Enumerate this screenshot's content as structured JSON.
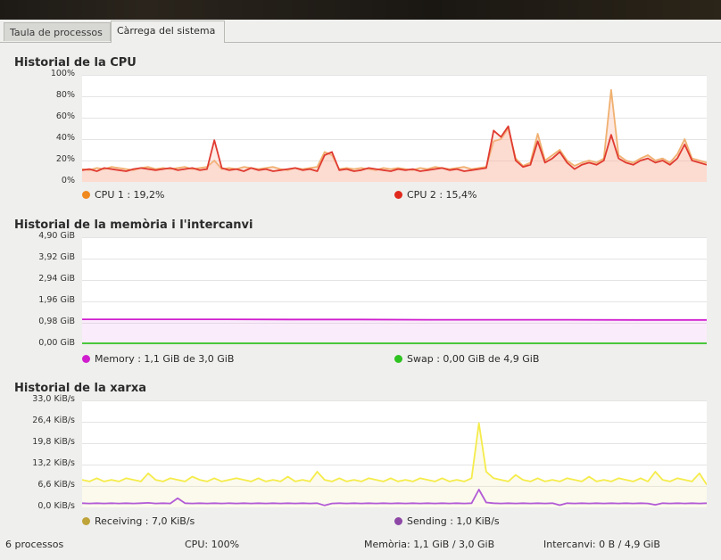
{
  "tabs": [
    {
      "label": "Taula de processos"
    },
    {
      "label": "Càrrega del sistema"
    }
  ],
  "cpu": {
    "title": "Historial de la CPU",
    "yticks": [
      "100%",
      "80%",
      "60%",
      "40%",
      "20%",
      "0%"
    ],
    "legend": [
      {
        "label": "CPU 1 : 19,2%",
        "color": "#f0891e"
      },
      {
        "label": "CPU 2 : 15,4%",
        "color": "#e02a1d"
      }
    ]
  },
  "memory": {
    "title": "Historial de la memòria i l'intercanvi",
    "yticks": [
      "4,90 GiB",
      "3,92 GiB",
      "2,94 GiB",
      "1,96 GiB",
      "0,98 GiB",
      "0,00 GiB"
    ],
    "legend": [
      {
        "label": "Memory : 1,1 GiB de 3,0 GiB",
        "color": "#d01ecf"
      },
      {
        "label": "Swap : 0,00 GiB de 4,9 GiB",
        "color": "#2ec320"
      }
    ]
  },
  "network": {
    "title": "Historial de la xarxa",
    "yticks": [
      "33,0 KiB/s",
      "26,4 KiB/s",
      "19,8 KiB/s",
      "13,2 KiB/s",
      "6,6 KiB/s",
      "0,0 KiB/s"
    ],
    "legend": [
      {
        "label": "Receiving : 7,0 KiB/s",
        "color": "#bfa43a"
      },
      {
        "label": "Sending : 1,0 KiB/s",
        "color": "#8d48a6"
      }
    ]
  },
  "status": {
    "processes": "6 processos",
    "cpu": "CPU: 100%",
    "memory": "Memòria: 1,1 GiB / 3,0 GiB",
    "swap": "Intercanvi: 0 B / 4,9 GiB"
  },
  "chart_data": [
    {
      "type": "line",
      "title": "Historial de la CPU",
      "ylim": [
        0,
        100
      ],
      "series": [
        {
          "name": "CPU 1 : 19,2%",
          "color": "#f0b070",
          "values": [
            12,
            11,
            13,
            12,
            14,
            13,
            12,
            11,
            13,
            14,
            12,
            13,
            12,
            13,
            14,
            12,
            13,
            14,
            20,
            12,
            13,
            12,
            14,
            13,
            12,
            13,
            14,
            12,
            11,
            13,
            12,
            13,
            14,
            28,
            25,
            12,
            13,
            12,
            13,
            12,
            11,
            13,
            12,
            13,
            12,
            11,
            13,
            12,
            14,
            13,
            12,
            13,
            14,
            12,
            13,
            14,
            38,
            40,
            50,
            22,
            15,
            18,
            45,
            20,
            25,
            30,
            20,
            15,
            18,
            20,
            18,
            22,
            86,
            25,
            20,
            18,
            22,
            25,
            20,
            22,
            18,
            26,
            40,
            22,
            20,
            18
          ]
        },
        {
          "name": "CPU 2 : 15,4%",
          "color": "#e03a30",
          "values": [
            11,
            12,
            10,
            13,
            12,
            11,
            10,
            12,
            13,
            12,
            11,
            12,
            13,
            11,
            12,
            13,
            11,
            12,
            39,
            13,
            11,
            12,
            10,
            13,
            11,
            12,
            10,
            11,
            12,
            13,
            11,
            12,
            10,
            25,
            28,
            11,
            12,
            10,
            11,
            13,
            12,
            11,
            10,
            12,
            11,
            12,
            10,
            11,
            12,
            13,
            11,
            12,
            10,
            11,
            12,
            13,
            48,
            42,
            52,
            20,
            14,
            16,
            38,
            18,
            22,
            28,
            18,
            12,
            16,
            18,
            16,
            20,
            44,
            22,
            18,
            16,
            20,
            22,
            18,
            20,
            16,
            22,
            35,
            20,
            18,
            16
          ]
        }
      ]
    },
    {
      "type": "area",
      "title": "Historial de la memòria i l'intercanvi",
      "ylim": [
        0,
        4.9
      ],
      "series": [
        {
          "name": "Memory : 1,1 GiB de 3,0 GiB",
          "color": "#d01ecf",
          "values": [
            1.14,
            1.14,
            1.14,
            1.13,
            1.13,
            1.12,
            1.12,
            1.12,
            1.11,
            1.11
          ]
        },
        {
          "name": "Swap : 0,00 GiB de 4,9 GiB",
          "color": "#2ec320",
          "values": [
            0,
            0,
            0,
            0,
            0,
            0,
            0,
            0,
            0,
            0
          ]
        }
      ]
    },
    {
      "type": "line",
      "title": "Historial de la xarxa",
      "ylim": [
        0,
        33
      ],
      "series": [
        {
          "name": "Receiving : 7,0 KiB/s",
          "color": "#f5ec4a",
          "values": [
            8.5,
            8,
            9,
            8,
            8.5,
            8,
            9,
            8.5,
            8,
            10.5,
            8.5,
            8,
            9,
            8.5,
            8,
            9.5,
            8.5,
            8,
            9,
            8,
            8.5,
            9,
            8.5,
            8,
            9,
            8,
            8.5,
            8,
            9.5,
            8,
            8.5,
            8,
            11,
            8.5,
            8,
            9,
            8,
            8.5,
            8,
            9,
            8.5,
            8,
            9,
            8,
            8.5,
            8,
            9,
            8.5,
            8,
            9,
            8,
            8.5,
            8,
            9,
            26,
            11,
            9,
            8.5,
            8,
            10,
            8.5,
            8,
            9,
            8,
            8.5,
            8,
            9,
            8.5,
            8,
            9.5,
            8,
            8.5,
            8,
            9,
            8.5,
            8,
            9,
            8,
            11,
            8.5,
            8,
            9,
            8.5,
            8,
            10.5,
            7
          ]
        },
        {
          "name": "Sending : 1,0 KiB/s",
          "color": "#b25ad6",
          "values": [
            1.3,
            1.2,
            1.3,
            1.2,
            1.3,
            1.2,
            1.3,
            1.2,
            1.3,
            1.4,
            1.2,
            1.3,
            1.2,
            2.8,
            1.3,
            1.2,
            1.3,
            1.2,
            1.3,
            1.2,
            1.3,
            1.2,
            1.3,
            1.2,
            1.3,
            1.2,
            1.3,
            1.2,
            1.3,
            1.2,
            1.3,
            1.2,
            1.3,
            0.6,
            1.2,
            1.3,
            1.2,
            1.3,
            1.2,
            1.3,
            1.2,
            1.3,
            1.2,
            1.3,
            1.2,
            1.3,
            1.2,
            1.3,
            1.2,
            1.3,
            1.2,
            1.3,
            1.2,
            1.3,
            5.5,
            1.5,
            1.3,
            1.2,
            1.3,
            1.2,
            1.3,
            1.2,
            1.3,
            1.2,
            1.3,
            0.7,
            1.3,
            1.2,
            1.3,
            1.2,
            1.3,
            1.2,
            1.3,
            1.2,
            1.3,
            1.2,
            1.3,
            1.2,
            0.8,
            1.3,
            1.2,
            1.3,
            1.2,
            1.3,
            1.2,
            1.3
          ]
        }
      ]
    }
  ]
}
